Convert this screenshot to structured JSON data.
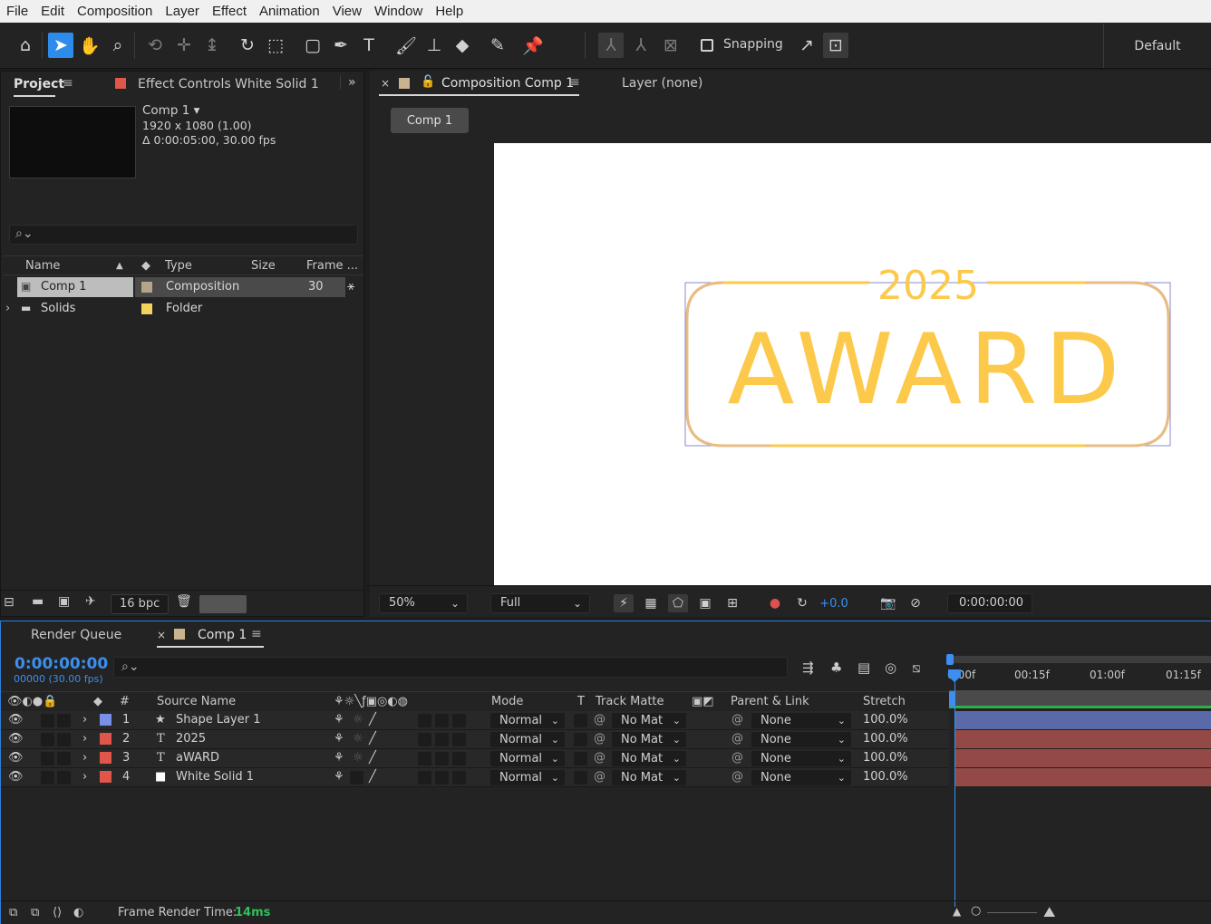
{
  "menu": [
    "File",
    "Edit",
    "Composition",
    "Layer",
    "Effect",
    "Animation",
    "View",
    "Window",
    "Help"
  ],
  "toolbar": {
    "snapping_label": "Snapping",
    "workspace": "Default"
  },
  "project": {
    "tab_label": "Project",
    "effect_controls_label": "Effect Controls White Solid 1",
    "comp_name": "Comp 1",
    "resolution": "1920 x 1080 (1.00)",
    "duration": "Δ 0:00:05:00, 30.00 fps",
    "columns": {
      "name": "Name",
      "type": "Type",
      "size": "Size",
      "frame": "Frame ..."
    },
    "items": [
      {
        "name": "Comp 1",
        "type": "Composition",
        "frame": "30",
        "label_color": "#b4a58a"
      },
      {
        "name": "Solids",
        "type": "Folder",
        "frame": "",
        "label_color": "#f2d45c"
      }
    ],
    "bpc": "16 bpc"
  },
  "viewer": {
    "tab_label": "Composition Comp 1",
    "layer_tab": "Layer (none)",
    "comp_chip": "Comp 1",
    "artwork": {
      "year": "2025",
      "title": "AWARD",
      "accent": "#fcc94a"
    },
    "zoom": "50%",
    "resolution": "Full",
    "exposure": "+0.0",
    "timecode": "0:00:00:00"
  },
  "timeline": {
    "render_queue_tab": "Render Queue",
    "comp_tab": "Comp 1",
    "timecode": "0:00:00:00",
    "fps": "00000 (30.00 fps)",
    "columns": {
      "num": "#",
      "source": "Source Name",
      "mode": "Mode",
      "t": "T",
      "track_matte": "Track Matte",
      "parent": "Parent & Link",
      "stretch": "Stretch"
    },
    "ruler": [
      "0:00f",
      "00:15f",
      "01:00f",
      "01:15f"
    ],
    "layers": [
      {
        "num": "1",
        "type_icon": "★",
        "name": "Shape Layer 1",
        "label_color": "#7a8fe8",
        "mode": "Normal",
        "matte": "No Mat",
        "parent": "None",
        "stretch": "100.0%",
        "bar_color": "#5a6aa8"
      },
      {
        "num": "2",
        "type_icon": "T",
        "name": "2025",
        "label_color": "#e0564b",
        "mode": "Normal",
        "matte": "No Mat",
        "parent": "None",
        "stretch": "100.0%",
        "bar_color": "#934a46"
      },
      {
        "num": "3",
        "type_icon": "T",
        "name": "aWARD",
        "label_color": "#e0564b",
        "mode": "Normal",
        "matte": "No Mat",
        "parent": "None",
        "stretch": "100.0%",
        "bar_color": "#934a46"
      },
      {
        "num": "4",
        "type_icon": "■",
        "name": "White Solid 1",
        "label_color": "#e0564b",
        "mode": "Normal",
        "matte": "No Mat",
        "parent": "None",
        "stretch": "100.0%",
        "bar_color": "#934a46"
      }
    ],
    "render_time_label": "Frame Render Time:",
    "render_time_value": "14ms"
  }
}
